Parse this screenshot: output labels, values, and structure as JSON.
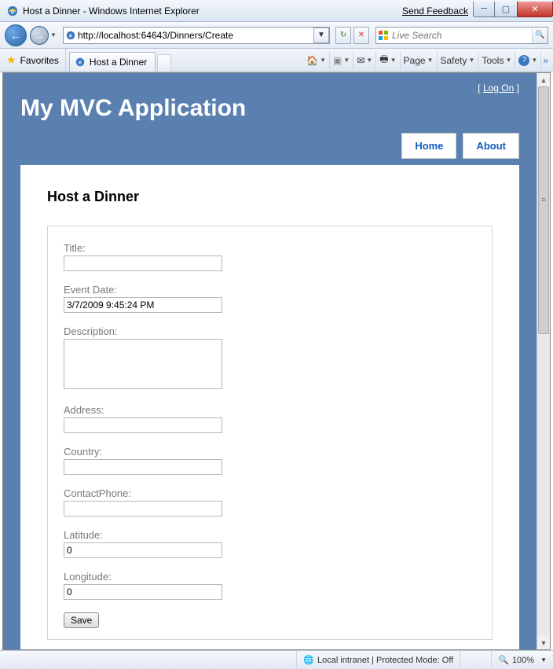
{
  "window": {
    "title": "Host a Dinner - Windows Internet Explorer",
    "feedback": "Send Feedback"
  },
  "address": {
    "url": "http://localhost:64643/Dinners/Create",
    "search_placeholder": "Live Search"
  },
  "favorites_label": "Favorites",
  "tab": {
    "label": "Host a Dinner"
  },
  "toolbar": {
    "page": "Page",
    "safety": "Safety",
    "tools": "Tools"
  },
  "app": {
    "logon": "Log On",
    "title": "My MVC Application",
    "nav": {
      "home": "Home",
      "about": "About"
    },
    "heading": "Host a Dinner"
  },
  "form": {
    "title_label": "Title:",
    "title_value": "",
    "eventdate_label": "Event Date:",
    "eventdate_value": "3/7/2009 9:45:24 PM",
    "description_label": "Description:",
    "description_value": "",
    "address_label": "Address:",
    "address_value": "",
    "country_label": "Country:",
    "country_value": "",
    "contactphone_label": "ContactPhone:",
    "contactphone_value": "",
    "latitude_label": "Latitude:",
    "latitude_value": "0",
    "longitude_label": "Longitude:",
    "longitude_value": "0",
    "save": "Save"
  },
  "status": {
    "zone": "Local intranet | Protected Mode: Off",
    "zoom": "100%"
  }
}
